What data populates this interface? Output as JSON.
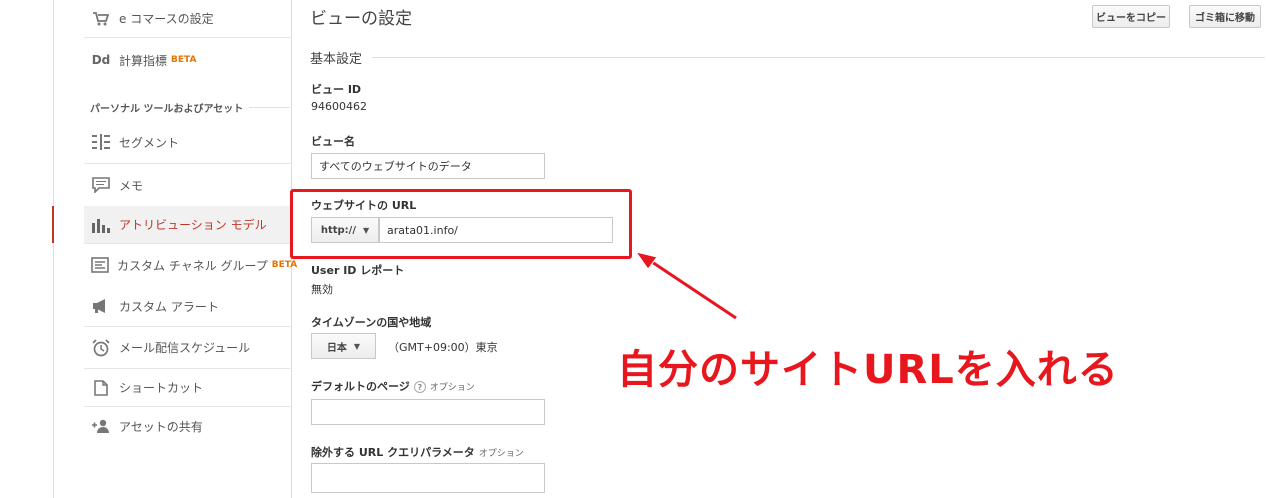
{
  "colors": {
    "accent_red": "#e8161d",
    "active_text": "#c1352b",
    "beta_orange": "#e37400"
  },
  "sidebar": {
    "section_title": "パーソナル ツールおよびアセット",
    "items": [
      {
        "label": "e コマースの設定",
        "icon": "cart-icon"
      },
      {
        "label": "計算指標",
        "beta": "BETA",
        "icon": "dd-icon"
      },
      {
        "label": "セグメント",
        "icon": "segments-icon"
      },
      {
        "label": "メモ",
        "icon": "note-icon"
      },
      {
        "label": "アトリビューション モデル",
        "icon": "attribution-chart-icon",
        "active": true
      },
      {
        "label": "カスタム チャネル グループ",
        "beta": "BETA",
        "icon": "channel-group-icon"
      },
      {
        "label": "カスタム アラート",
        "icon": "megaphone-icon"
      },
      {
        "label": "メール配信スケジュール",
        "icon": "alarm-clock-icon"
      },
      {
        "label": "ショートカット",
        "icon": "document-icon"
      },
      {
        "label": "アセットの共有",
        "icon": "add-user-icon"
      }
    ]
  },
  "main": {
    "title": "ビューの設定",
    "copy_view_label": "ビューをコピー",
    "trash_label": "ゴミ箱に移動",
    "section_title": "基本設定",
    "view_id_label": "ビュー ID",
    "view_id_value": "94600462",
    "view_name_label": "ビュー名",
    "view_name_value": "すべてのウェブサイトのデータ",
    "url_label": "ウェブサイトの URL",
    "protocol_value": "http://",
    "url_value": "arata01.info/",
    "userid_label": "User ID レポート",
    "userid_value": "無効",
    "timezone_label": "タイムゾーンの国や地域",
    "country_value": "日本",
    "timezone_value": "（GMT+09:00）東京",
    "default_page_label": "デフォルトのページ",
    "default_page_help": "?",
    "option_label": "オプション",
    "default_page_value": "",
    "exclude_params_label": "除外する URL クエリパラメータ",
    "exclude_params_value": ""
  },
  "annotation": {
    "text": "自分のサイトURLを入れる"
  }
}
